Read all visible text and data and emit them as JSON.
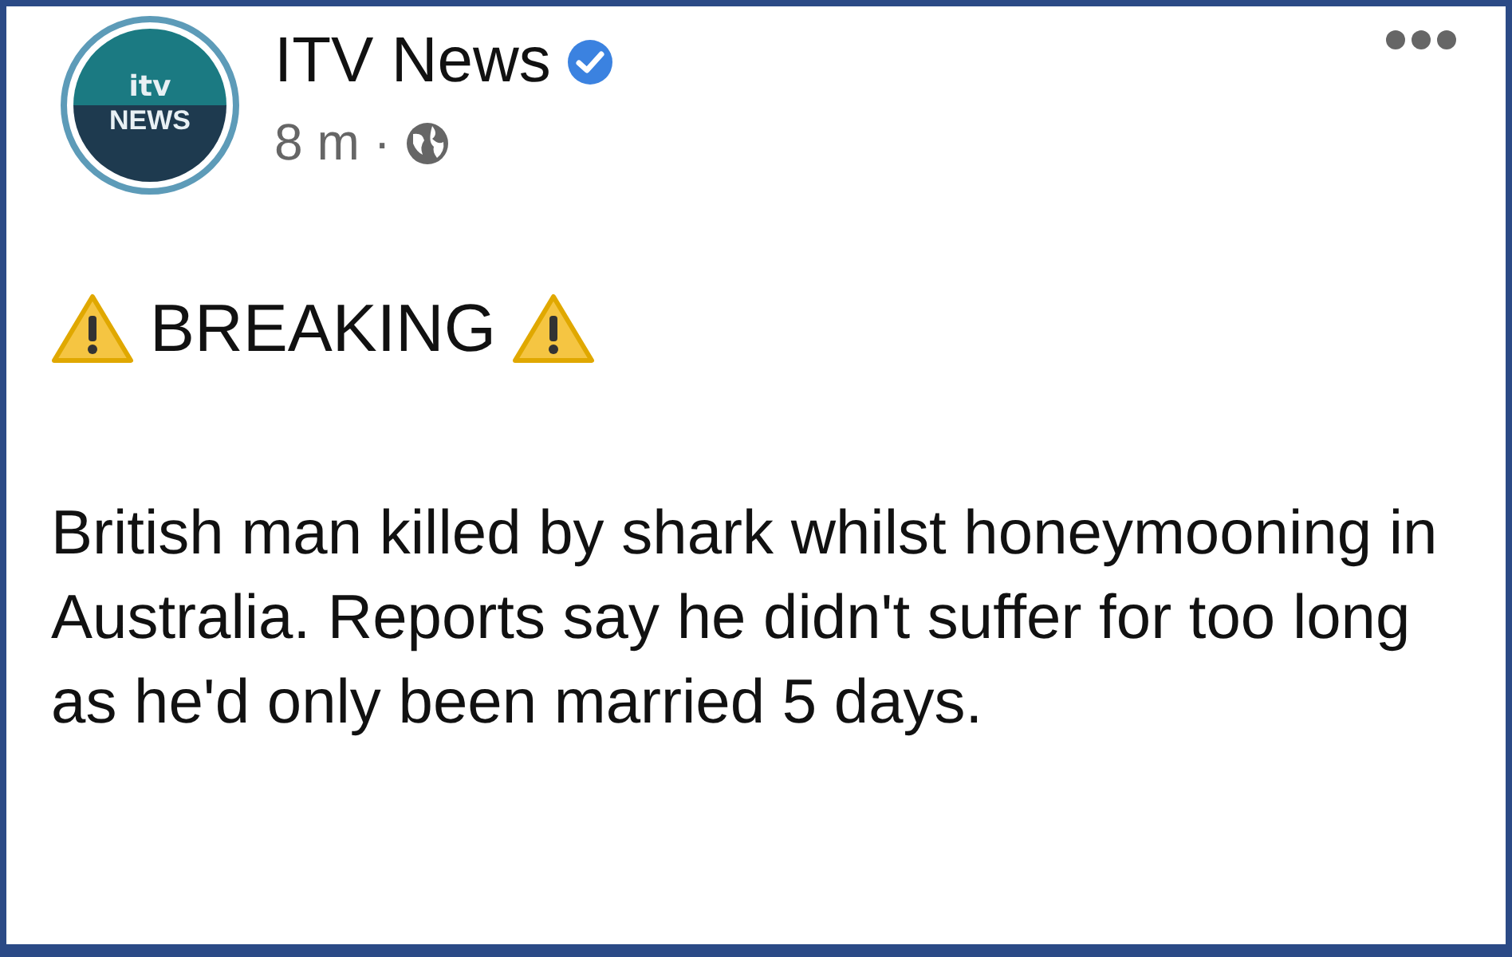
{
  "post": {
    "avatar": {
      "logo": "itv",
      "label": "NEWS"
    },
    "author": "ITV News",
    "verified": true,
    "time": "8 m ·",
    "headline": "BREAKING",
    "body": "British man killed by shark whilst honeymooning in Australia. Reports say he didn't suffer for too long as he'd only been married 5 days."
  }
}
